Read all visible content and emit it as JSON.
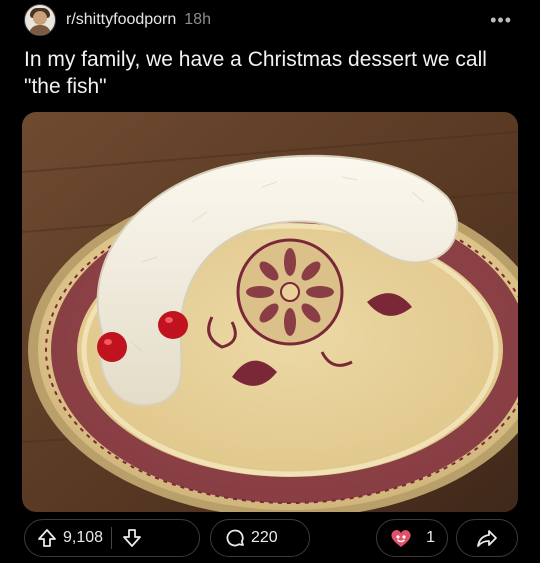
{
  "post": {
    "subreddit": "r/shittyfoodporn",
    "age": "18h",
    "title": "In my family, we have a Christmas dessert we call \"the fish\"",
    "more_menu": "•••"
  },
  "actions": {
    "upvotes": "9,108",
    "comments": "220",
    "awards": "1"
  },
  "icons": [
    "avatar",
    "more-options-icon",
    "upvote-arrow-icon",
    "downvote-arrow-icon",
    "comment-bubble-icon",
    "award-icon",
    "share-arrow-icon"
  ],
  "colors": {
    "background": "#000000",
    "text": "#ffffff",
    "muted": "#8c8c8c",
    "pill_border": "#3a3a3a",
    "award_accent": "#e05268"
  }
}
